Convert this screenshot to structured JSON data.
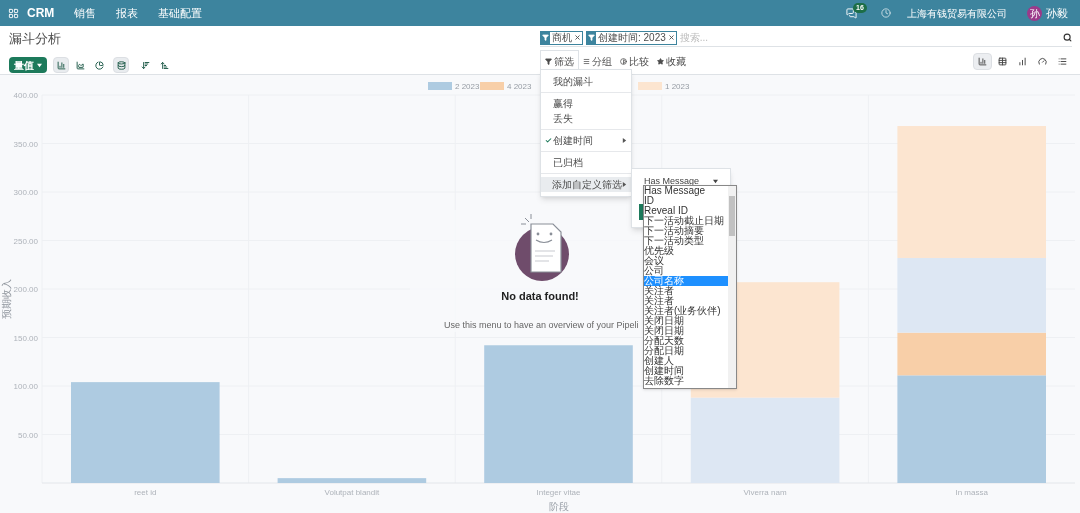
{
  "navbar": {
    "app": "CRM",
    "menus": [
      "销售",
      "报表",
      "基础配置"
    ],
    "message_count": "16",
    "company": "上海有钱贸易有限公司",
    "avatar_initial": "孙",
    "user": "孙毅"
  },
  "page_title": "漏斗分析",
  "search": {
    "facets": [
      {
        "label": "商机"
      },
      {
        "label": "创建时间: 2023"
      }
    ],
    "placeholder": "搜索..."
  },
  "measure_button": "量值",
  "chart_tools": [
    {
      "kind": "bar",
      "selected": true
    },
    {
      "kind": "line",
      "selected": false
    },
    {
      "kind": "pie",
      "selected": false
    },
    {
      "kind": "stacked",
      "selected": true
    },
    {
      "kind": "sort_desc",
      "selected": false
    },
    {
      "kind": "sort_asc",
      "selected": false
    }
  ],
  "search_tabs": [
    {
      "kind": "filter",
      "label": "筛选",
      "selected": true
    },
    {
      "kind": "group",
      "label": "分组",
      "selected": false
    },
    {
      "kind": "compare",
      "label": "比较",
      "selected": false
    },
    {
      "kind": "favorite",
      "label": "收藏",
      "selected": false
    }
  ],
  "views": [
    {
      "kind": "graph",
      "selected": true
    },
    {
      "kind": "pivot",
      "selected": false
    },
    {
      "kind": "cohort",
      "selected": false
    },
    {
      "kind": "dashboard",
      "selected": false
    },
    {
      "kind": "list",
      "selected": false
    }
  ],
  "filter_menu": [
    {
      "items": [
        {
          "label": "我的漏斗",
          "checked": false,
          "submenu": false,
          "hovered": false
        }
      ]
    },
    {
      "items": [
        {
          "label": "赢得",
          "checked": false,
          "submenu": false,
          "hovered": false
        },
        {
          "label": "丢失",
          "checked": false,
          "submenu": false,
          "hovered": false
        }
      ]
    },
    {
      "items": [
        {
          "label": "创建时间",
          "checked": true,
          "submenu": true,
          "hovered": false
        }
      ]
    },
    {
      "items": [
        {
          "label": "已归档",
          "checked": false,
          "submenu": false,
          "hovered": false
        }
      ]
    },
    {
      "items": [
        {
          "label": "添加自定义筛选",
          "checked": false,
          "submenu": true,
          "hovered": true
        }
      ]
    }
  ],
  "custom_filter": {
    "field": "Has Message",
    "options": [
      {
        "label": "Has Message",
        "selected": false
      },
      {
        "label": "ID",
        "selected": false
      },
      {
        "label": "Reveal ID",
        "selected": false
      },
      {
        "label": "下一活动截止日期",
        "selected": false
      },
      {
        "label": "下一活动摘要",
        "selected": false
      },
      {
        "label": "下一活动类型",
        "selected": false
      },
      {
        "label": "优先级",
        "selected": false
      },
      {
        "label": "会议",
        "selected": false
      },
      {
        "label": "公司",
        "selected": false
      },
      {
        "label": "公司名称",
        "selected": true
      },
      {
        "label": "关注者",
        "selected": false
      },
      {
        "label": "关注者",
        "selected": false
      },
      {
        "label": "关注者(业务伙伴)",
        "selected": false
      },
      {
        "label": "关闭日期",
        "selected": false
      },
      {
        "label": "关闭日期",
        "selected": false
      },
      {
        "label": "分配天数",
        "selected": false
      },
      {
        "label": "分配日期",
        "selected": false
      },
      {
        "label": "创建人",
        "selected": false
      },
      {
        "label": "创建时间",
        "selected": false
      },
      {
        "label": "去除数字",
        "selected": false
      }
    ]
  },
  "empty_state": {
    "title": "No data found!",
    "text": "Use this menu to have an overview of your Pipeli"
  },
  "chart": {
    "chart_data": {
      "type": "bar",
      "stacked": true,
      "grid": true,
      "legend": "top",
      "xlabel": "阶段",
      "ylabel": "预期收入",
      "categories": [
        "reet id",
        "Volutpat blandit",
        "Integer vitae",
        "Viverra nam",
        "In massa"
      ],
      "yticks": [
        {
          "value": 50,
          "label": "50.00"
        },
        {
          "value": 100,
          "label": "100.00"
        },
        {
          "value": 150,
          "label": "150.00"
        },
        {
          "value": 200,
          "label": "200.00"
        },
        {
          "value": 250,
          "label": "250.00"
        },
        {
          "value": 300,
          "label": "300.00"
        },
        {
          "value": 350,
          "label": "350.00"
        },
        {
          "value": 400,
          "label": "400.00"
        }
      ],
      "ylim": [
        0,
        400
      ],
      "series": [
        {
          "name": "2 2023",
          "color": "#aecbe1",
          "values": [
            104,
            5,
            142,
            null,
            111
          ]
        },
        {
          "name": "4 2023",
          "color": "#f8cfa8",
          "values": [
            null,
            null,
            null,
            null,
            44
          ]
        },
        {
          "color": "#dde7f3",
          "values": [
            null,
            null,
            null,
            88,
            77
          ]
        },
        {
          "name": "1 2023",
          "color": "#fce5d0",
          "values": [
            null,
            null,
            null,
            119,
            136
          ]
        }
      ]
    }
  }
}
